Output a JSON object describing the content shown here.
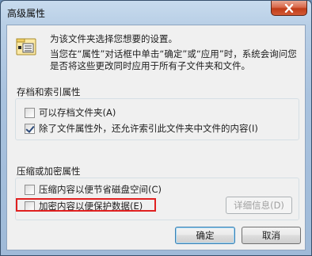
{
  "window": {
    "title": "高级属性"
  },
  "header": {
    "line1": "为该文件夹选择您想要的设置。",
    "line2": "当您在“属性”对话框中单击“确定”或“应用”时，系统会询问您是否将这些更改同时应用于所有子文件夹和文件。"
  },
  "archive_group": {
    "label": "存档和索引属性",
    "items": [
      {
        "label": "可以存档文件夹(A)",
        "checked": false
      },
      {
        "label": "除了文件属性外，还允许索引此文件夹中文件的内容(I)",
        "checked": true
      }
    ]
  },
  "compress_group": {
    "label": "压缩或加密属性",
    "items": [
      {
        "label": "压缩内容以便节省磁盘空间(C)",
        "checked": false
      },
      {
        "label": "加密内容以便保护数据(E)",
        "checked": false
      }
    ],
    "details_button": "详细信息(D)"
  },
  "buttons": {
    "ok": "确定",
    "cancel": "取消"
  },
  "colors": {
    "highlight": "#e02020",
    "close_button": "#c03c18"
  }
}
